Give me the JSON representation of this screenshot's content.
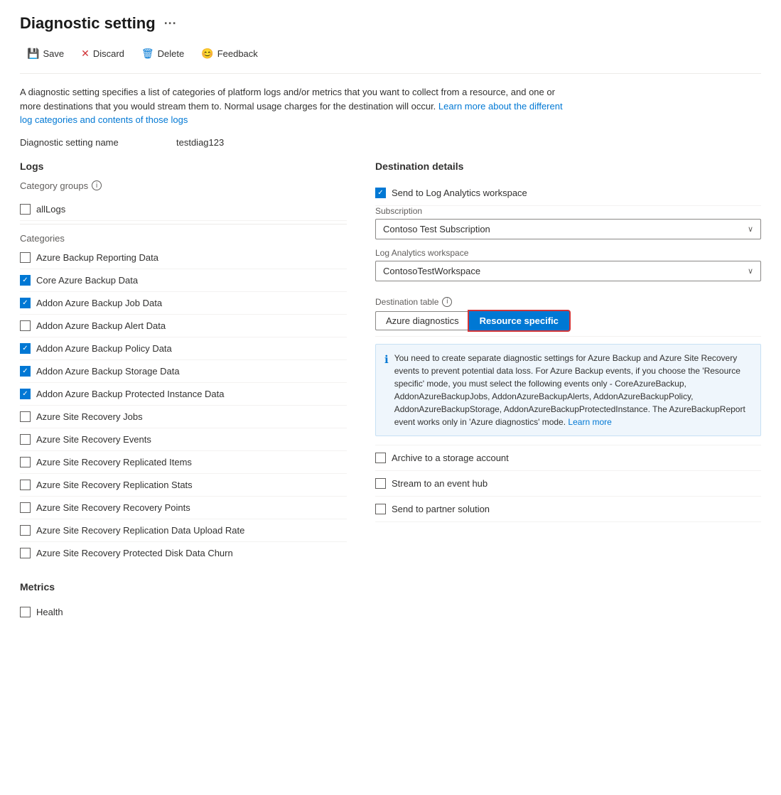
{
  "page": {
    "title": "Diagnostic setting",
    "ellipsis": "···"
  },
  "toolbar": {
    "save_label": "Save",
    "discard_label": "Discard",
    "delete_label": "Delete",
    "feedback_label": "Feedback"
  },
  "description": {
    "text1": "A diagnostic setting specifies a list of categories of platform logs and/or metrics that you want to collect from a resource, and one or more destinations that you would stream them to. Normal usage charges for the destination will occur.",
    "link_text": "Learn more about the different log categories and contents of those logs",
    "link_href": "#"
  },
  "setting_name": {
    "label": "Diagnostic setting name",
    "value": "testdiag123"
  },
  "logs": {
    "title": "Logs",
    "category_groups_label": "Category groups",
    "all_logs_label": "allLogs",
    "all_logs_checked": false,
    "categories_label": "Categories",
    "categories": [
      {
        "label": "Azure Backup Reporting Data",
        "checked": false
      },
      {
        "label": "Core Azure Backup Data",
        "checked": true
      },
      {
        "label": "Addon Azure Backup Job Data",
        "checked": true
      },
      {
        "label": "Addon Azure Backup Alert Data",
        "checked": false
      },
      {
        "label": "Addon Azure Backup Policy Data",
        "checked": true
      },
      {
        "label": "Addon Azure Backup Storage Data",
        "checked": true
      },
      {
        "label": "Addon Azure Backup Protected Instance Data",
        "checked": true
      },
      {
        "label": "Azure Site Recovery Jobs",
        "checked": false
      },
      {
        "label": "Azure Site Recovery Events",
        "checked": false
      },
      {
        "label": "Azure Site Recovery Replicated Items",
        "checked": false
      },
      {
        "label": "Azure Site Recovery Replication Stats",
        "checked": false
      },
      {
        "label": "Azure Site Recovery Recovery Points",
        "checked": false
      },
      {
        "label": "Azure Site Recovery Replication Data Upload Rate",
        "checked": false
      },
      {
        "label": "Azure Site Recovery Protected Disk Data Churn",
        "checked": false
      }
    ]
  },
  "metrics": {
    "title": "Metrics",
    "items": [
      {
        "label": "Health",
        "checked": false
      }
    ]
  },
  "destination": {
    "title": "Destination details",
    "send_to_log_analytics": {
      "label": "Send to Log Analytics workspace",
      "checked": true
    },
    "subscription": {
      "label": "Subscription",
      "value": "Contoso Test Subscription"
    },
    "workspace": {
      "label": "Log Analytics workspace",
      "value": "ContosoTestWorkspace"
    },
    "destination_table": {
      "label": "Destination table",
      "azure_diagnostics_label": "Azure diagnostics",
      "resource_specific_label": "Resource specific"
    },
    "info_box": {
      "text": "You need to create separate diagnostic settings for Azure Backup and Azure Site Recovery events to prevent potential data loss. For Azure Backup events, if you choose the 'Resource specific' mode, you must select the following events only - CoreAzureBackup, AddonAzureBackupJobs, AddonAzureBackupAlerts, AddonAzureBackupPolicy, AddonAzureBackupStorage, AddonAzureBackupProtectedInstance. The AzureBackupReport event works only in 'Azure diagnostics' mode.",
      "link_text": "Learn more",
      "link_href": "#"
    },
    "archive_to_storage": {
      "label": "Archive to a storage account",
      "checked": false
    },
    "stream_to_event_hub": {
      "label": "Stream to an event hub",
      "checked": false
    },
    "send_to_partner": {
      "label": "Send to partner solution",
      "checked": false
    }
  }
}
